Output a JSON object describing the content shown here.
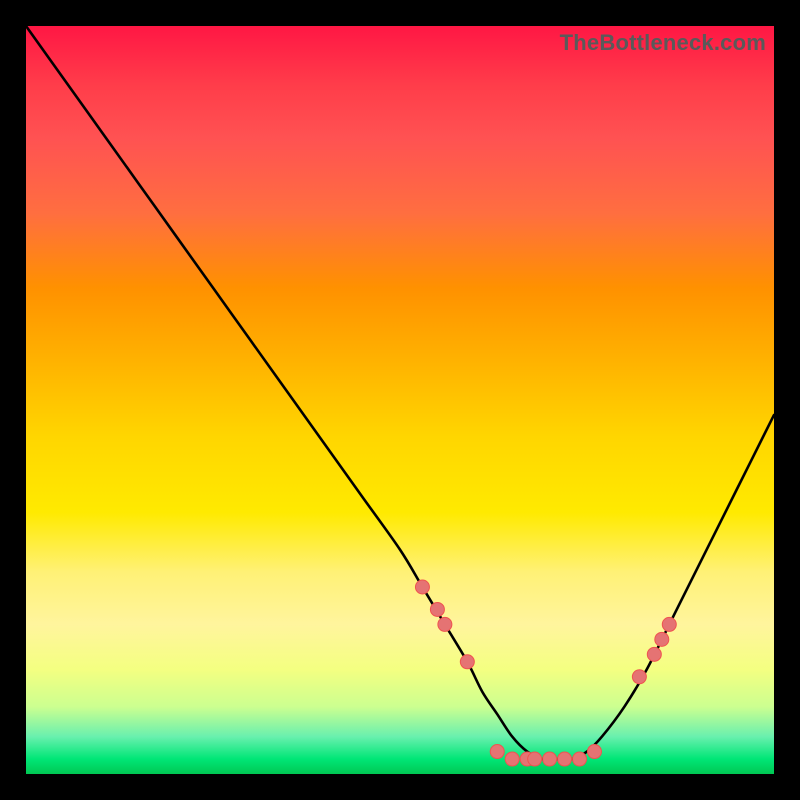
{
  "watermark": "TheBottleneck.com",
  "chart_data": {
    "type": "line",
    "title": "",
    "xlabel": "",
    "ylabel": "",
    "xlim": [
      0,
      100
    ],
    "ylim": [
      0,
      100
    ],
    "x": [
      0,
      5,
      10,
      15,
      20,
      25,
      30,
      35,
      40,
      45,
      50,
      53,
      56,
      59,
      61,
      63,
      65,
      67,
      69,
      71,
      73,
      75,
      77,
      80,
      83,
      87,
      91,
      95,
      100
    ],
    "values": [
      100,
      93,
      86,
      79,
      72,
      65,
      58,
      51,
      44,
      37,
      30,
      25,
      20,
      15,
      11,
      8,
      5,
      3,
      2,
      2,
      2,
      3,
      5,
      9,
      14,
      22,
      30,
      38,
      48
    ],
    "series_name": "bottleneck-curve",
    "markers": [
      {
        "x": 53,
        "y": 25
      },
      {
        "x": 55,
        "y": 22
      },
      {
        "x": 56,
        "y": 20
      },
      {
        "x": 59,
        "y": 15
      },
      {
        "x": 63,
        "y": 3
      },
      {
        "x": 65,
        "y": 2
      },
      {
        "x": 67,
        "y": 2
      },
      {
        "x": 68,
        "y": 2
      },
      {
        "x": 70,
        "y": 2
      },
      {
        "x": 72,
        "y": 2
      },
      {
        "x": 74,
        "y": 2
      },
      {
        "x": 76,
        "y": 3
      },
      {
        "x": 82,
        "y": 13
      },
      {
        "x": 84,
        "y": 16
      },
      {
        "x": 85,
        "y": 18
      },
      {
        "x": 86,
        "y": 20
      }
    ],
    "marker_color": "#e57373",
    "curve_color": "#000000",
    "gradient_stops": [
      {
        "pos": 0,
        "color": "#ff1744"
      },
      {
        "pos": 50,
        "color": "#ffd600"
      },
      {
        "pos": 100,
        "color": "#00c853"
      }
    ]
  }
}
